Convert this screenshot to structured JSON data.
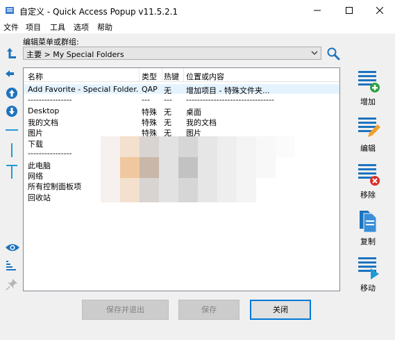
{
  "window": {
    "title": "自定义 - Quick Access Popup v11.5.2.1"
  },
  "menu": {
    "items": [
      "文件",
      "项目",
      "工具",
      "选项",
      "帮助"
    ]
  },
  "editor": {
    "label": "编辑菜单或群组:",
    "selected_menu": "主要 > My Special Folders"
  },
  "list": {
    "columns": [
      "名称",
      "类型",
      "热键",
      "位置或内容"
    ],
    "rows": [
      [
        "Add Favorite - Special Folder...",
        "QAP",
        "无",
        "增加项目 - 特殊文件夹..."
      ],
      [
        "----------------",
        "---",
        "---",
        "--------------------------------"
      ],
      [
        "Desktop",
        "特殊",
        "无",
        "桌面"
      ],
      [
        "我的文档",
        "特殊",
        "无",
        "我的文档"
      ],
      [
        "图片",
        "特殊",
        "无",
        "图片"
      ],
      [
        "下载",
        "",
        "",
        ""
      ],
      [
        "----------------",
        "",
        "",
        ""
      ],
      [
        "此电脑",
        "",
        "",
        ""
      ],
      [
        "网络",
        "",
        "",
        ""
      ],
      [
        "所有控制面板项",
        "",
        "",
        ""
      ],
      [
        "回收站",
        "",
        "",
        ""
      ]
    ]
  },
  "actions": {
    "add": "增加",
    "edit": "编辑",
    "remove": "移除",
    "copy": "复制",
    "move": "移动"
  },
  "buttons": {
    "save_exit": "保存并退出",
    "save": "保存",
    "close": "关闭"
  },
  "colors": {
    "accent": "#0078d7",
    "icon_blue": "#1e73be",
    "add_green": "#2ea043",
    "remove_red": "#d9302c",
    "selected_row": "#e5f3ff"
  }
}
